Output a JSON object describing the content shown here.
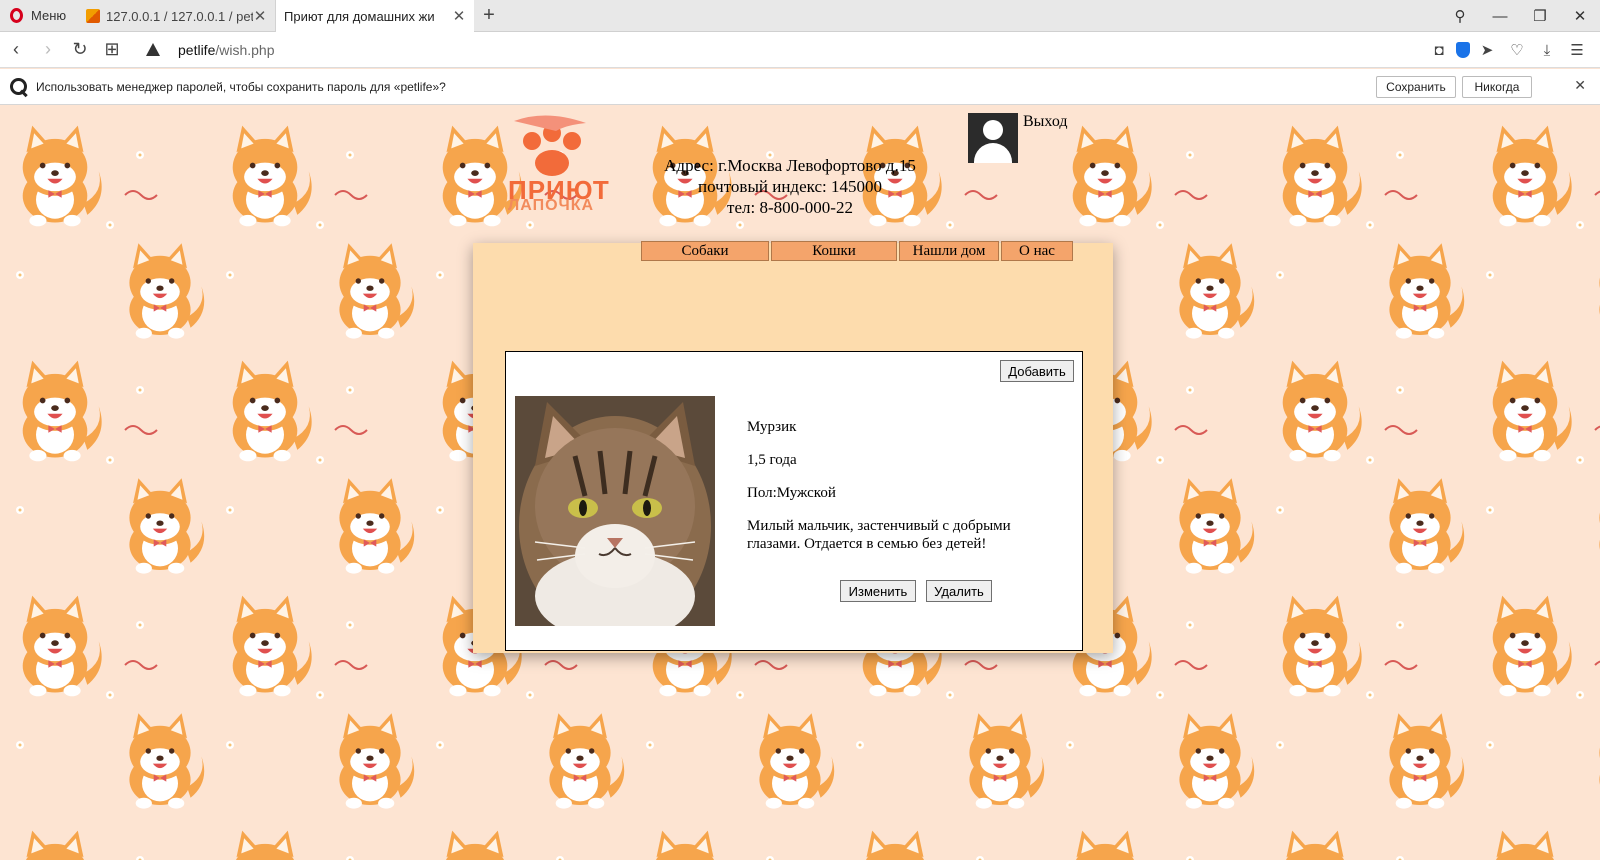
{
  "browser": {
    "menu_label": "Меню",
    "tabs": [
      {
        "title": "127.0.0.1 / 127.0.0.1 / pet /",
        "active": false
      },
      {
        "title": "Приют для домашних жи",
        "active": true
      }
    ],
    "new_tab": "+",
    "url_host": "petlife",
    "url_path": "/wish.php"
  },
  "password_bar": {
    "message": "Использовать менеджер паролей, чтобы сохранить пароль для «petlife»?",
    "save_label": "Сохранить",
    "never_label": "Никогда"
  },
  "header": {
    "logo_line1": "ПРИЮТ",
    "logo_line2": "ЛАПОЧКА",
    "address_line1": "Адрес: г.Москва Левофортово д.15",
    "address_line2": "почтовый индекс: 145000",
    "address_line3": "тел: 8-800-000-22",
    "logout_label": "Выход"
  },
  "nav": {
    "items": [
      {
        "label": "Собаки"
      },
      {
        "label": "Кошки"
      },
      {
        "label": "Нашли дом"
      },
      {
        "label": "О нас"
      }
    ]
  },
  "card": {
    "add_label": "Добавить",
    "name": "Мурзик",
    "age": "1,5 года",
    "gender": "Пол:Мужской",
    "description": "Милый мальчик, застенчивый с добрыми глазами. Отдается в семью без детей!",
    "edit_label": "Изменить",
    "delete_label": "Удалить"
  },
  "colors": {
    "page_bg": "#fde4d2",
    "panel_bg": "#fddcad",
    "nav_bg": "#f4a46b",
    "brand": "#f26b3a"
  }
}
